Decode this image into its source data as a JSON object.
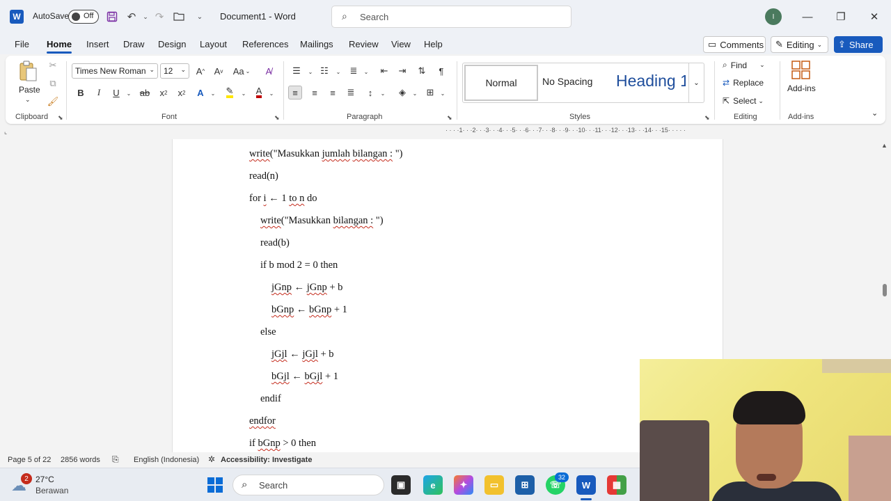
{
  "titlebar": {
    "app_icon": "word-icon",
    "app_letter": "W",
    "autosave_label": "AutoSave",
    "autosave_state": "Off",
    "doc_title": "Document1  -  Word",
    "search_placeholder": "Search",
    "user_initial": "I"
  },
  "menu": {
    "tabs": [
      "File",
      "Home",
      "Insert",
      "Draw",
      "Design",
      "Layout",
      "References",
      "Mailings",
      "Review",
      "View",
      "Help"
    ],
    "active_tab": "Home",
    "comments_label": "Comments",
    "editing_label": "Editing",
    "share_label": "Share"
  },
  "ribbon": {
    "clipboard": {
      "paste_label": "Paste",
      "group_label": "Clipboard"
    },
    "font": {
      "font_name": "Times New Roman",
      "font_size": "12",
      "group_label": "Font",
      "change_case": "Aa"
    },
    "paragraph": {
      "group_label": "Paragraph"
    },
    "styles": {
      "normal": "Normal",
      "no_spacing": "No Spacing",
      "heading1": "Heading 1",
      "group_label": "Styles"
    },
    "editing": {
      "find": "Find",
      "replace": "Replace",
      "select": "Select",
      "group_label": "Editing"
    },
    "addins": {
      "label": "Add-ins",
      "group_label": "Add-ins"
    }
  },
  "ruler": {
    "text": "· · · ·1· · ·2· · ·3· · ·4· · ·5· · ·6· · ·7· · ·8· · ·9· · ·10· · ·11· · ·12· · ·13· · ·14· · ·15· · ·  · ·"
  },
  "document": {
    "lines": [
      {
        "indent": 0,
        "parts": [
          {
            "t": "write",
            "s": true
          },
          {
            "t": "(\"Masukkan "
          },
          {
            "t": "jumlah",
            "s": true
          },
          {
            "t": " "
          },
          {
            "t": "bilangan :",
            "s": true
          },
          {
            "t": " \")"
          }
        ]
      },
      {
        "indent": 0,
        "parts": [
          {
            "t": "read(n)"
          }
        ]
      },
      {
        "indent": 0,
        "parts": [
          {
            "t": "for "
          },
          {
            "t": "i",
            "s": true
          },
          {
            "t": " ← 1 "
          },
          {
            "t": "to n",
            "s": true
          },
          {
            "t": " do"
          }
        ]
      },
      {
        "indent": 1,
        "parts": [
          {
            "t": "write",
            "s": true
          },
          {
            "t": "(\"Masukkan "
          },
          {
            "t": "bilangan :",
            "s": true
          },
          {
            "t": " \")"
          }
        ]
      },
      {
        "indent": 1,
        "parts": [
          {
            "t": "read(b)"
          }
        ]
      },
      {
        "indent": 1,
        "parts": [
          {
            "t": "if b mod 2 = 0 then"
          }
        ]
      },
      {
        "indent": 2,
        "parts": [
          {
            "t": "jGnp",
            "s": true
          },
          {
            "t": " ← "
          },
          {
            "t": "jGnp",
            "s": true
          },
          {
            "t": " + b"
          }
        ]
      },
      {
        "indent": 2,
        "parts": [
          {
            "t": "bGnp",
            "s": true
          },
          {
            "t": " ← "
          },
          {
            "t": "bGnp",
            "s": true
          },
          {
            "t": " + 1"
          }
        ]
      },
      {
        "indent": 1,
        "parts": [
          {
            "t": "else"
          }
        ]
      },
      {
        "indent": 2,
        "parts": [
          {
            "t": "jGjl",
            "s": true
          },
          {
            "t": " ← "
          },
          {
            "t": "jGjl",
            "s": true
          },
          {
            "t": " + b"
          }
        ]
      },
      {
        "indent": 2,
        "parts": [
          {
            "t": "bGjl",
            "s": true
          },
          {
            "t": " ← "
          },
          {
            "t": "bGjl",
            "s": true
          },
          {
            "t": " + 1"
          }
        ]
      },
      {
        "indent": 1,
        "parts": [
          {
            "t": "endif"
          }
        ]
      },
      {
        "indent": 0,
        "parts": [
          {
            "t": "endfor",
            "s": true
          }
        ]
      },
      {
        "indent": 0,
        "parts": [
          {
            "t": "if "
          },
          {
            "t": "bGnp",
            "s": true
          },
          {
            "t": " > 0 then"
          }
        ]
      }
    ]
  },
  "statusbar": {
    "page": "Page 5 of 22",
    "words": "2856 words",
    "language": "English (Indonesia)",
    "accessibility": "Accessibility: Investigate"
  },
  "taskbar": {
    "weather_badge": "2",
    "temperature": "27°C",
    "condition": "Berawan",
    "search_placeholder": "Search",
    "whatsapp_badge": "32"
  },
  "colors": {
    "accent": "#185abd",
    "squiggle": "#c42b1c"
  }
}
